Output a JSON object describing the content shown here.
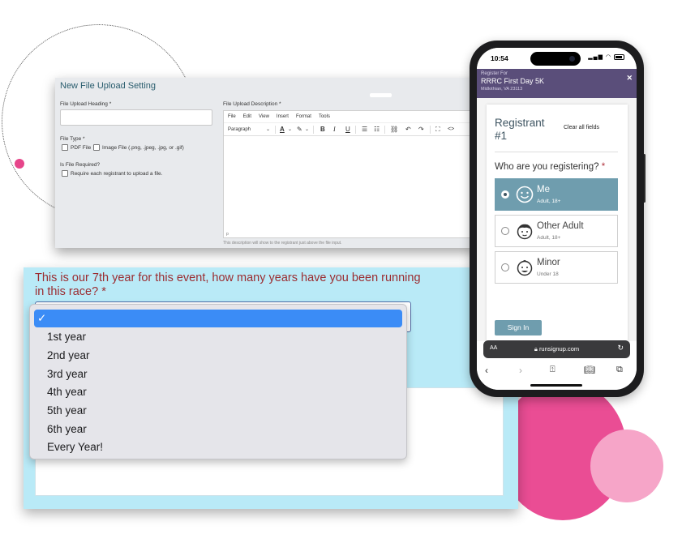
{
  "file_upload": {
    "title": "New File Upload Setting",
    "heading_label": "File Upload Heading *",
    "heading_value": "",
    "file_type_label": "File Type *",
    "pdf_label": "PDF File",
    "image_label": "Image File (.png, .jpeg, .jpg, or .gif)",
    "required_label": "Is File Required?",
    "require_each_label": "Require each registrant to upload a file.",
    "description_label": "File Upload Description *",
    "menu": [
      "File",
      "Edit",
      "View",
      "Insert",
      "Format",
      "Tools"
    ],
    "paragraph_select": "Paragraph",
    "editor_status": "p",
    "description_hint": "This description will show to the registrant just above the file input."
  },
  "question": {
    "text": "This is our 7th year for this event, how many years have you been running in this race? *",
    "options": [
      "",
      "1st year",
      "2nd year",
      "3rd year",
      "4th year",
      "5th year",
      "6th year",
      "Every Year!"
    ],
    "selected_index": 0,
    "selected_mark": "✓"
  },
  "phone": {
    "time": "10:54",
    "header_small": "Register For",
    "header_title": "RRRC First Day 5K",
    "header_location": "Midlothian, VA 23113",
    "registrant_title": "Registrant #1",
    "clear_all": "Clear all fields",
    "who_question": "Who are you registering?",
    "required_mark": "*",
    "options": [
      {
        "name": "Me",
        "sub": "Adult, 18+",
        "active": true,
        "face": "smiley-face-icon"
      },
      {
        "name": "Other Adult",
        "sub": "Adult, 18+",
        "active": false,
        "face": "adult-face-icon"
      },
      {
        "name": "Minor",
        "sub": "Under 18",
        "active": false,
        "face": "child-face-icon"
      }
    ],
    "sign_in": "Sign In",
    "url_aa": "AA",
    "url": "runsignup.com",
    "accent_color": "#6f9dae",
    "header_color": "#5a4e7a"
  },
  "colors": {
    "question_text": "#9b2c30",
    "question_bg": "#b9eaf7",
    "pink": "#ea4d94"
  }
}
